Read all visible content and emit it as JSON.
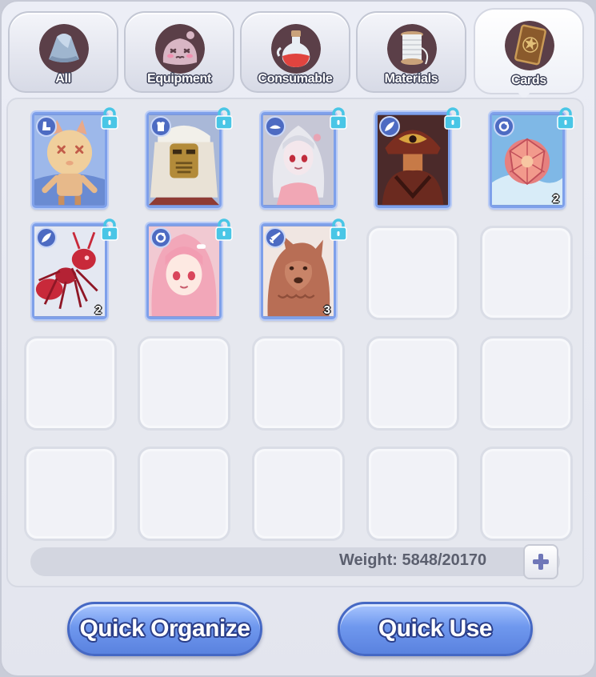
{
  "tabs": [
    {
      "label": "All",
      "icon": "rock-icon",
      "active": false
    },
    {
      "label": "Equipment",
      "icon": "poring-icon",
      "active": false
    },
    {
      "label": "Consumable",
      "icon": "potion-icon",
      "active": false
    },
    {
      "label": "Materials",
      "icon": "spool-icon",
      "active": false
    },
    {
      "label": "Cards",
      "icon": "card-icon",
      "active": true
    }
  ],
  "cards": [
    {
      "name": "Rotar Zairo-style scarecrow doll",
      "type_icon": "boot-icon",
      "quantity": "",
      "locked": true
    },
    {
      "name": "Mummy-masked elder",
      "type_icon": "armor-icon",
      "quantity": "",
      "locked": true
    },
    {
      "name": "Silver-haired girl",
      "type_icon": "hat-icon",
      "quantity": "",
      "locked": true
    },
    {
      "name": "Hooded eye-emblem figure",
      "type_icon": "feather-icon",
      "quantity": "",
      "locked": true
    },
    {
      "name": "Pink faceted orb",
      "type_icon": "accessory-icon",
      "quantity": "2",
      "locked": true
    },
    {
      "name": "Red ant",
      "type_icon": "feather-icon",
      "quantity": "2",
      "locked": true
    },
    {
      "name": "Pink-haired girl",
      "type_icon": "accessory-icon",
      "quantity": "",
      "locked": true
    },
    {
      "name": "Brown werewolf",
      "type_icon": "sword-icon",
      "quantity": "3",
      "locked": true
    }
  ],
  "weight": {
    "label": "Weight: 5848/20170"
  },
  "buttons": {
    "quick_organize": "Quick Organize",
    "quick_use": "Quick Use"
  },
  "colors": {
    "accent": "#5a82df",
    "card_frame": "#7ea0ea",
    "lock": "#49c6e6"
  }
}
